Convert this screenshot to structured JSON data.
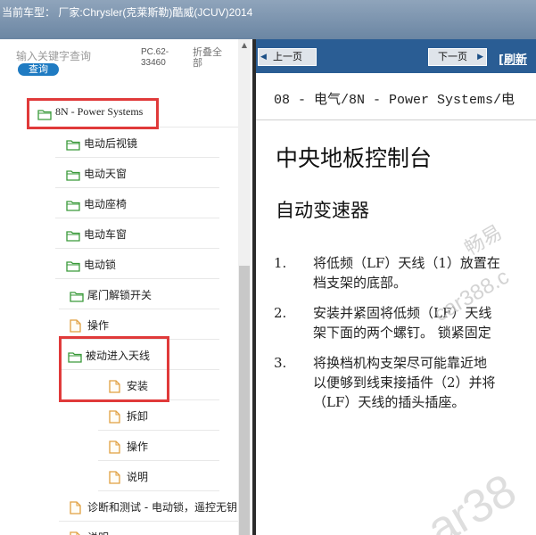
{
  "window": {
    "title": "当前车型： 厂家:Chrysler(克莱斯勒)酷威(JCUV)2014"
  },
  "search": {
    "placeholder": "输入关键字查询",
    "button": "查询",
    "code": "PC.62-33460",
    "collapse_all": "折叠全部"
  },
  "tree": {
    "items": [
      {
        "label": "8N - Power Systems",
        "icon": "folder-open-icon"
      },
      {
        "label": "电动后视镜",
        "icon": "folder-open-icon"
      },
      {
        "label": "电动天窗",
        "icon": "folder-open-icon"
      },
      {
        "label": "电动座椅",
        "icon": "folder-open-icon"
      },
      {
        "label": "电动车窗",
        "icon": "folder-open-icon"
      },
      {
        "label": "电动锁",
        "icon": "folder-open-icon"
      },
      {
        "label": "尾门解锁开关",
        "icon": "folder-open-icon"
      },
      {
        "label": "操作",
        "icon": "document-icon"
      },
      {
        "label": "被动进入天线",
        "icon": "folder-open-icon"
      },
      {
        "label": "安装",
        "icon": "document-icon"
      },
      {
        "label": "拆卸",
        "icon": "document-icon"
      },
      {
        "label": "操作",
        "icon": "document-icon"
      },
      {
        "label": "说明",
        "icon": "document-icon"
      },
      {
        "label": "诊断和测试 - 电动锁，遥控无钥",
        "icon": "document-icon"
      },
      {
        "label": "说明",
        "icon": "document-icon"
      }
    ]
  },
  "nav": {
    "prev": "上一页",
    "next": "下一页",
    "refresh": "[刷新",
    "prev_icon": "arrow-left-icon",
    "next_icon": "arrow-right-icon"
  },
  "doc": {
    "breadcrumb": "08 - 电气/8N - Power Systems/电",
    "title": "中央地板控制台",
    "subtitle": "自动变速器",
    "steps": [
      {
        "num": "1.",
        "text": "将低频（LF）天线（1）放置在\n档支架的底部。"
      },
      {
        "num": "2.",
        "text": "安装并紧固将低频（LF）天线\n架下面的两个螺钉。 锁紧固定"
      },
      {
        "num": "3.",
        "text": "将换档机构支架尽可能靠近地\n以便够到线束接插件（2）并将\n（LF）天线的插头插座。"
      }
    ]
  },
  "colors": {
    "highlight": "#e03a3a",
    "nav_bar": "#2a5d94",
    "folder": "#3a9a3a",
    "document": "#e0a040"
  }
}
